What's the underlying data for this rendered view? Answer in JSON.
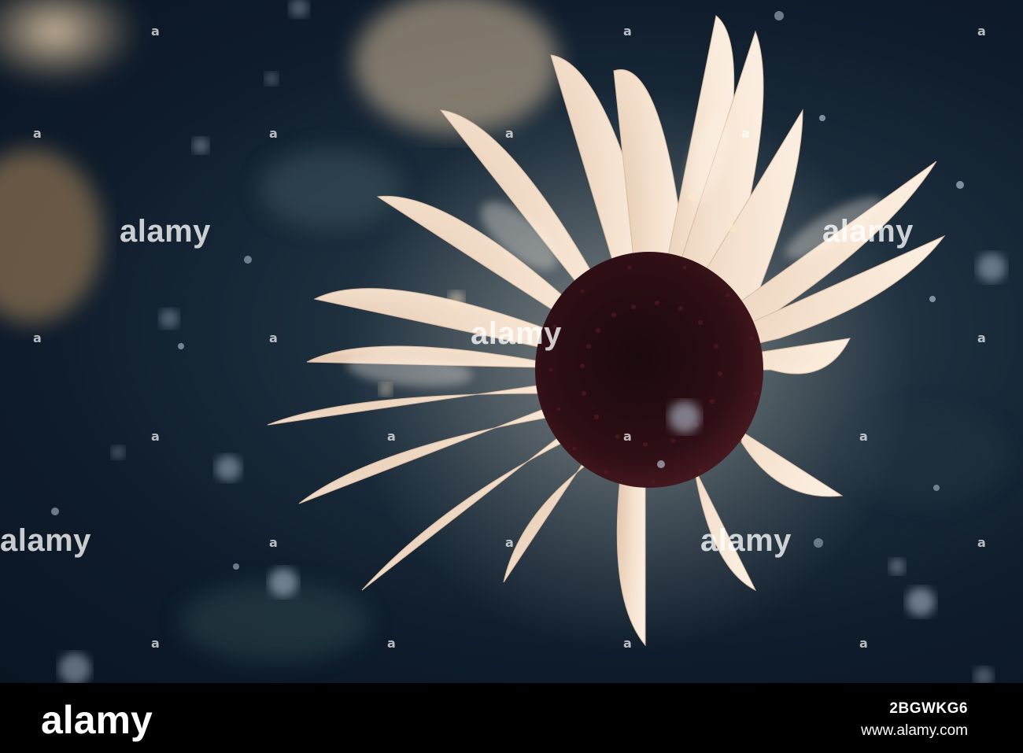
{
  "photo": {
    "subject": "Close-up of a pale cream sunflower with a dark center against a dark blue bokeh background",
    "colors": {
      "background": "#0f1c2b",
      "petal": "#f2dcc6",
      "petal_shadow": "#c9ad96",
      "center": "#2a0d12",
      "bokeh": "#b8c8dc"
    }
  },
  "watermark": {
    "text": "alamy",
    "mark": "a"
  },
  "footer": {
    "brand": "alamy",
    "image_id": "2BGWKG6",
    "url": "www.alamy.com"
  }
}
